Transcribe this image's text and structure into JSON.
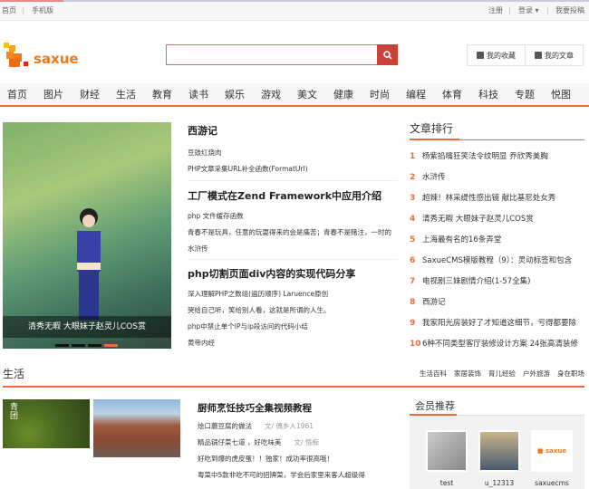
{
  "topbar": {
    "home": "首页",
    "mobile": "手机版",
    "register": "注册",
    "login": "登录",
    "submit": "我要投稿"
  },
  "logo": {
    "text": "saxue"
  },
  "header": {
    "search_placeholder": "",
    "favorites": "我的收藏",
    "my_articles": "我的文章"
  },
  "nav": [
    "首页",
    "图片",
    "财经",
    "生活",
    "教育",
    "读书",
    "娱乐",
    "游戏",
    "美文",
    "健康",
    "时尚",
    "编程",
    "体育",
    "科技",
    "专题",
    "悦图"
  ],
  "slider": {
    "caption": "清秀无暇 大眼妹子赵灵儿COS赏",
    "active_dot": 4,
    "dots": 4
  },
  "featured": [
    {
      "title": "西游记",
      "items": [
        "豆豉红烧肉",
        "PHP文章采集URL补全函数(FormatUrl)"
      ]
    },
    {
      "title": "工厂模式在Zend Framework中应用介绍",
      "items": [
        "php 文件缓存函数",
        "青春不是玩具，任意的玩耍得来的会是痛苦；青春不是赌注，一时的",
        "水浒传"
      ]
    },
    {
      "title": "php切割页面div内容的实现代码分享",
      "items": [
        "深入理解PHP之数组(遍历顺序) Laruence原创",
        "哭给自己听，笑给别人看，这就是所谓的人生。",
        "php中禁止单个IP与ip段访问的代码小结",
        "黄帝内经"
      ]
    }
  ],
  "ranking": {
    "title": "文章排行",
    "items": [
      "杨紫掐嘴狂笑法令纹明显 乔欣秀美胸",
      "水浒传",
      "超辣！林采缇性感出镜 献比基尼处女秀",
      "清秀无暇 大眼妹子赵灵儿COS赏",
      "上海最有名的16条弄堂",
      "SaxueCMS模版教程（9）：灵动标签和包含",
      "电视剧三妹剧情介绍(1-57全集)",
      "西游记",
      "我家阳光房装好了才知道这细节，亏得都要除",
      "6种不同类型客厅装修设计方案 24张高清装修"
    ]
  },
  "life": {
    "title": "生活",
    "tags": [
      "生活百科",
      "家居装饰",
      "育儿经验",
      "户外旅游",
      "身在职场"
    ],
    "image1_text": "青团",
    "headline": "厨师烹饪技巧全集视频教程",
    "items": [
      {
        "text": "烩口蘑豆腐的做法",
        "author": "文/ 偶乡人1961"
      },
      {
        "text": "精品锅仔菜七道 ，好吃味美",
        "author": "文/ 悟痴"
      },
      {
        "text": "好吃到爆的虎皮蛋！！独家！成功率很高哦！",
        "author": ""
      },
      {
        "text": "粤菜中5款非吃不可的招牌菜，学会后家里来客人超级得",
        "author": ""
      }
    ]
  },
  "members": {
    "title": "会员推荐",
    "users": [
      "test",
      "u_12313",
      "saxuecms"
    ]
  }
}
